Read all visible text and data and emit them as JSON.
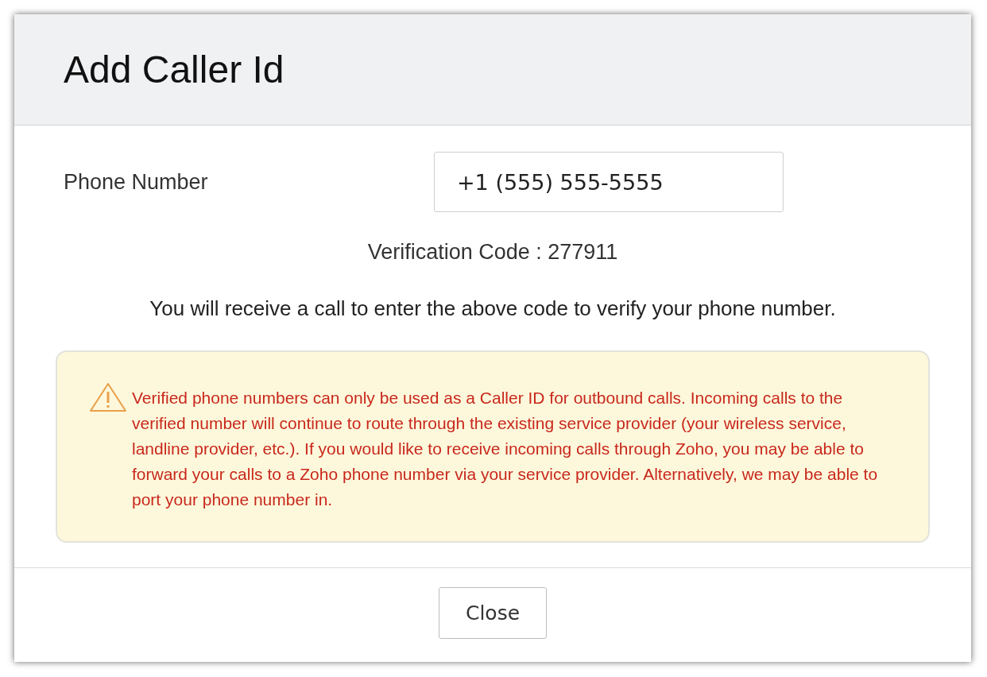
{
  "dialog": {
    "title": "Add Caller Id",
    "phone_number": {
      "label": "Phone Number",
      "value": "+1 (555) 555-5555"
    },
    "verification": "Verification Code : 277911",
    "instruction": "You will receive a call to enter the above code to verify your phone number.",
    "warning": "Verified phone numbers can only be used as a Caller ID for outbound calls. Incoming calls to the verified number will continue to route through the existing service provider (your wireless service, landline provider, etc.). If you would like to receive incoming calls through Zoho, you may be able to forward your calls to a Zoho phone number via your service provider. Alternatively, we may be able to port your phone number in.",
    "buttons": [
      "Close"
    ]
  }
}
